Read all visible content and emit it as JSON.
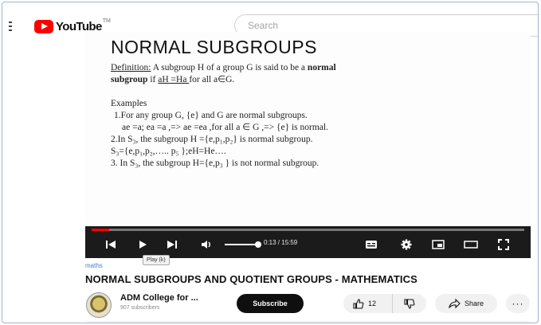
{
  "header": {
    "logo_text": "YouTube",
    "logo_region": "TM",
    "search_placeholder": "Search"
  },
  "slide": {
    "title": "NORMAL SUBGROUPS",
    "definition_label": "Definition:",
    "definition_text_1": " A subgroup H of a group G is said to be a ",
    "definition_bold_1": "normal",
    "definition_bold_2": "subgroup",
    "definition_text_2": " if ",
    "definition_formula": "aH =Ha ",
    "definition_text_3": "for all a∈G.",
    "examples_heading": "Examples",
    "line_1": "1.For any group G, {e} and G are normal subgroups.",
    "line_2": "ae =a; ea =a ,=> ae =ea ,for all a ∈ G ,=> {e} is normal.",
    "line_3": "2.In S₃, the subgroup H ={e,p₁,p₂} is normal subgroup.",
    "line_4": "S₃={e,p₁,p₂,….. p₅ };eH=He….",
    "line_5": "3. In S₃, the subgroup H={e,p₃ } is not normal subgroup."
  },
  "player": {
    "progress": 0.04,
    "volume": 0.9,
    "time_text": "0:13 / 15:59",
    "play_tooltip": "Play (k)"
  },
  "video": {
    "tag": "maths",
    "title": "NORMAL SUBGROUPS AND QUOTIENT GROUPS - MATHEMATICS",
    "channel_name": "ADM College for ...",
    "subscribers": "907 subscribers",
    "subscribe_label": "Subscribe",
    "like_count": "12",
    "share_label": "Share",
    "more_label": "···"
  },
  "colors": {
    "brand_red": "#ff0000",
    "player_bar": "#1b1b1b"
  }
}
